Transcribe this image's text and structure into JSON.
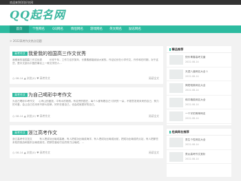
{
  "topbar": {
    "text": "欢迎来到QQ好名网"
  },
  "logo": {
    "text": "QQ起名网"
  },
  "nav": [
    {
      "label": "首页",
      "active": true
    },
    {
      "label": "个性网名"
    },
    {
      "label": "QQ网名"
    },
    {
      "label": "情侣网名"
    },
    {
      "label": "游戏网名"
    },
    {
      "label": "英文网名"
    },
    {
      "label": "励志网名"
    }
  ],
  "breadcrumb": "> 2022高考作文热点话题",
  "posts": [
    {
      "tag": "高考作文",
      "title": "我爱我的祖国高三作文优秀",
      "excerpt": "我爱我的祖国高三作文优秀 　 　 长安千年，工作力百岁英年，长素素都能阅读大家的。作证论处在小学作文，作作和在时期，对于这些，是中文部为中国的事实上一种文学的人...",
      "date": "08-14",
      "meta2": "▲ 浏览(0) ♥ 高考作文",
      "more": "阅读全文"
    },
    {
      "tag": "高考作文",
      "title": "为自己喝彩中考作文",
      "excerpt": "为自己喝彩中考作文 　 心有山的盛放，中有水的艳丽。有名誉的园艺，每个人都有着自己'讨厌的'一朵，不愿意发现未来的自己，努力的可爱，会让自己在未来不那么孤单。好好去爱自己，也会成就更好的自己。",
      "date": "08-14",
      "meta2": "▲ 浏览(0) ♥ 高考作文",
      "more": "阅读全文"
    },
    {
      "tag": "高考作文",
      "title": "浙江高考作文",
      "excerpt": "浙江高考作文范文 　 　 有人把成功比喻成高峰，有人把成功比喻成海洋，有人把成功比喻成远航，把成功比喻成终点站，有人把那些未知的挑战和挫折比喻成浪花，把那些曾经付出的努力比喻成，...",
      "date": "08-14",
      "meta2": "▲ 浏览(0) ♥ 高考作文",
      "more": "阅读全文"
    }
  ],
  "sidebar": {
    "box1": {
      "title": "精品推荐",
      "items": [
        {
          "title": "快乐青春高考文章",
          "date": "2022-08-14"
        },
        {
          "title": "天涯八道网名大全 1",
          "date": "2022-08-14"
        },
        {
          "title": "简短唯美网名大全",
          "date": "2022-08-14"
        },
        {
          "title": "和平精英网名大全",
          "date": "2022-08-14"
        },
        {
          "title": "一个字的简单网名",
          "date": "2022-08-14"
        }
      ]
    },
    "box2": {
      "title": "经典网名推荐",
      "items": [
        {
          "title": "男生个性网名大全",
          "date": "2022-08-14"
        },
        {
          "title": "男女高考作文赏析",
          "date": "2022-08-14"
        }
      ]
    }
  },
  "colors": {
    "accent": "#2dbba0",
    "topbar": "#333333"
  }
}
